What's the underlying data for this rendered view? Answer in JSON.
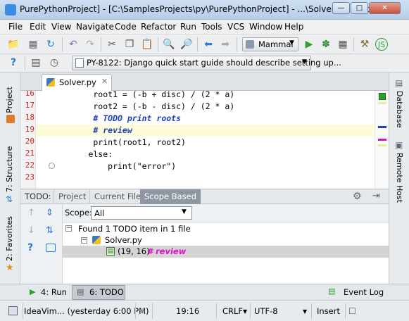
{
  "window": {
    "title": "PurePythonProject] - [C:\\SamplesProjects\\py\\PurePythonProject] - ...\\Solver\\Solver.py - ..."
  },
  "menu": [
    "File",
    "Edit",
    "View",
    "Navigate",
    "Code",
    "Refactor",
    "Run",
    "Tools",
    "VCS",
    "Window",
    "Help"
  ],
  "toolbar": {
    "run_config": "Mammal"
  },
  "task": {
    "label": "PY-8122: Django quick start guide should describe setting up..."
  },
  "left_tools": {
    "project": "1: Project",
    "structure": "7: Structure",
    "favorites": "2: Favorites"
  },
  "right_tools": {
    "database": "Database",
    "remote_host": "Remote Host"
  },
  "editor": {
    "tab": "Solver.py",
    "lines": [
      {
        "num": "16",
        "code": "        root1 = (-b + disc) / (2 * a)"
      },
      {
        "num": "17",
        "code": "        root2 = (-b - disc) / (2 * a)"
      },
      {
        "num": "18",
        "code": "        # TODO print roots"
      },
      {
        "num": "19",
        "code": "        # review"
      },
      {
        "num": "20",
        "code": "        print(root1, root2)"
      },
      {
        "num": "21",
        "code": "       else:"
      },
      {
        "num": "22",
        "code": "           print(\"error\")"
      },
      {
        "num": "23",
        "code": ""
      }
    ]
  },
  "todo": {
    "label": "TODO:",
    "tabs": [
      "Project",
      "Current File",
      "Scope Based"
    ],
    "scope_label": "Scope:",
    "scope_value": "All",
    "tree_root": "Found 1 TODO item in 1 file",
    "tree_file": "Solver.py",
    "tree_item_pos": "(19, 16)",
    "tree_item_text": "# review"
  },
  "bottom": {
    "run": "4: Run",
    "todo": "6: TODO",
    "event_log": "Event Log"
  },
  "status": {
    "vcs": "IdeaVim... (yesterday 6:00 PM)",
    "position": "19:16",
    "line_sep": "CRLF",
    "encoding": "UTF-8",
    "mode": "Insert"
  },
  "colors": {
    "todo": "#1b3fbd",
    "review": "#e010c8",
    "line_number": "#cc2222",
    "highlight": "#fdfbd8"
  }
}
